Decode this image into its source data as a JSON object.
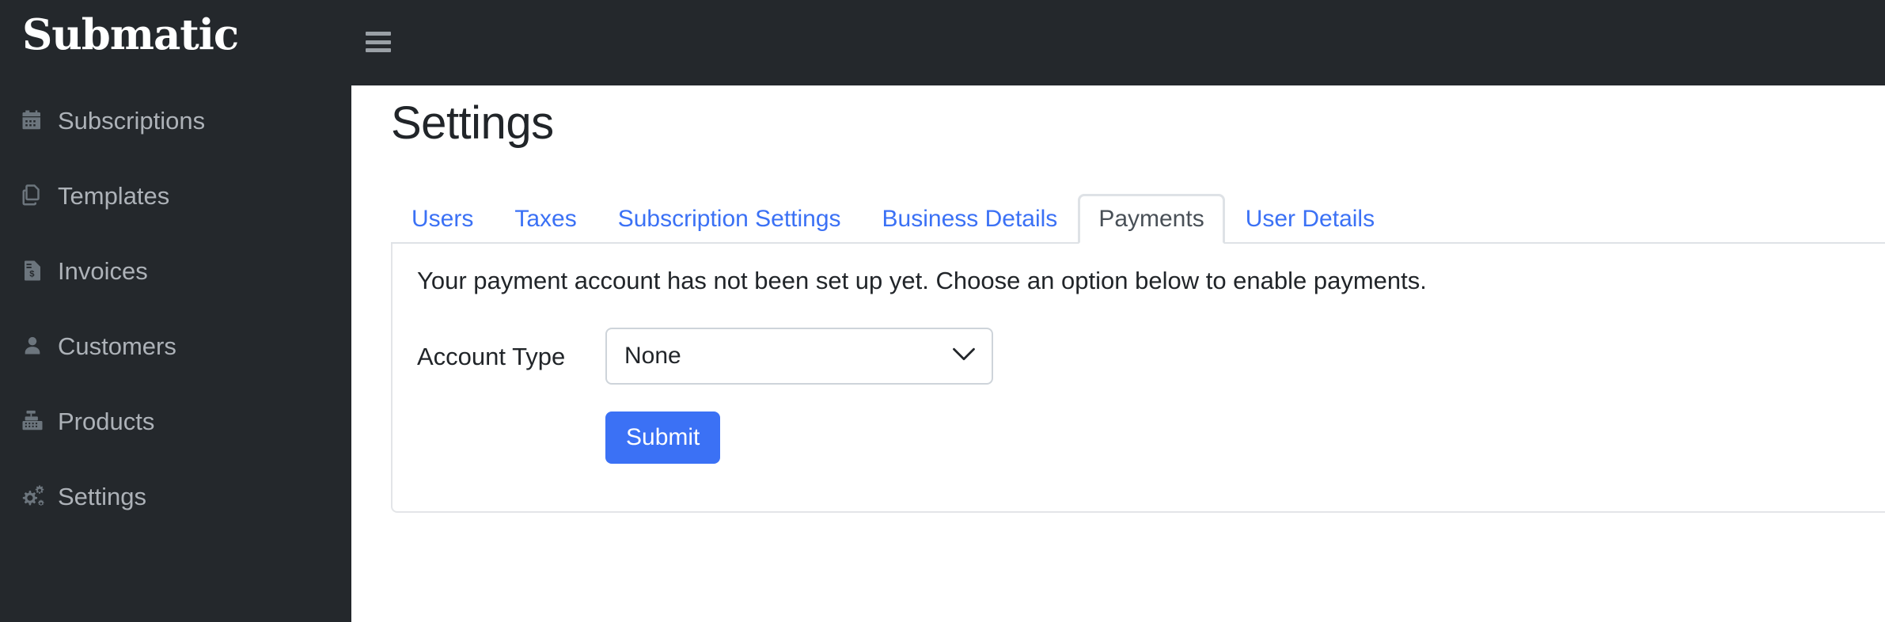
{
  "brand": {
    "logo_text": "Submatic"
  },
  "topbar": {
    "menu_icon": "hamburger-icon"
  },
  "sidebar": {
    "items": [
      {
        "label": "Subscriptions",
        "icon": "calendar-icon"
      },
      {
        "label": "Templates",
        "icon": "copy-documents-icon"
      },
      {
        "label": "Invoices",
        "icon": "invoice-dollar-icon"
      },
      {
        "label": "Customers",
        "icon": "person-icon"
      },
      {
        "label": "Products",
        "icon": "cash-register-icon"
      },
      {
        "label": "Settings",
        "icon": "cogs-icon"
      }
    ]
  },
  "main": {
    "page_title": "Settings",
    "tabs": [
      {
        "label": "Users",
        "active": false
      },
      {
        "label": "Taxes",
        "active": false
      },
      {
        "label": "Subscription Settings",
        "active": false
      },
      {
        "label": "Business Details",
        "active": false
      },
      {
        "label": "Payments",
        "active": true
      },
      {
        "label": "User Details",
        "active": false
      }
    ],
    "payments_panel": {
      "notice": "Your payment account has not been set up yet. Choose an option below to enable payments.",
      "account_type_label": "Account Type",
      "account_type_value": "None",
      "account_type_options": [
        "None"
      ],
      "submit_label": "Submit"
    }
  },
  "colors": {
    "sidebar_bg": "#24282c",
    "accent_blue": "#3b71f5",
    "text_dark": "#212529",
    "border_gray": "#dee2e6"
  }
}
